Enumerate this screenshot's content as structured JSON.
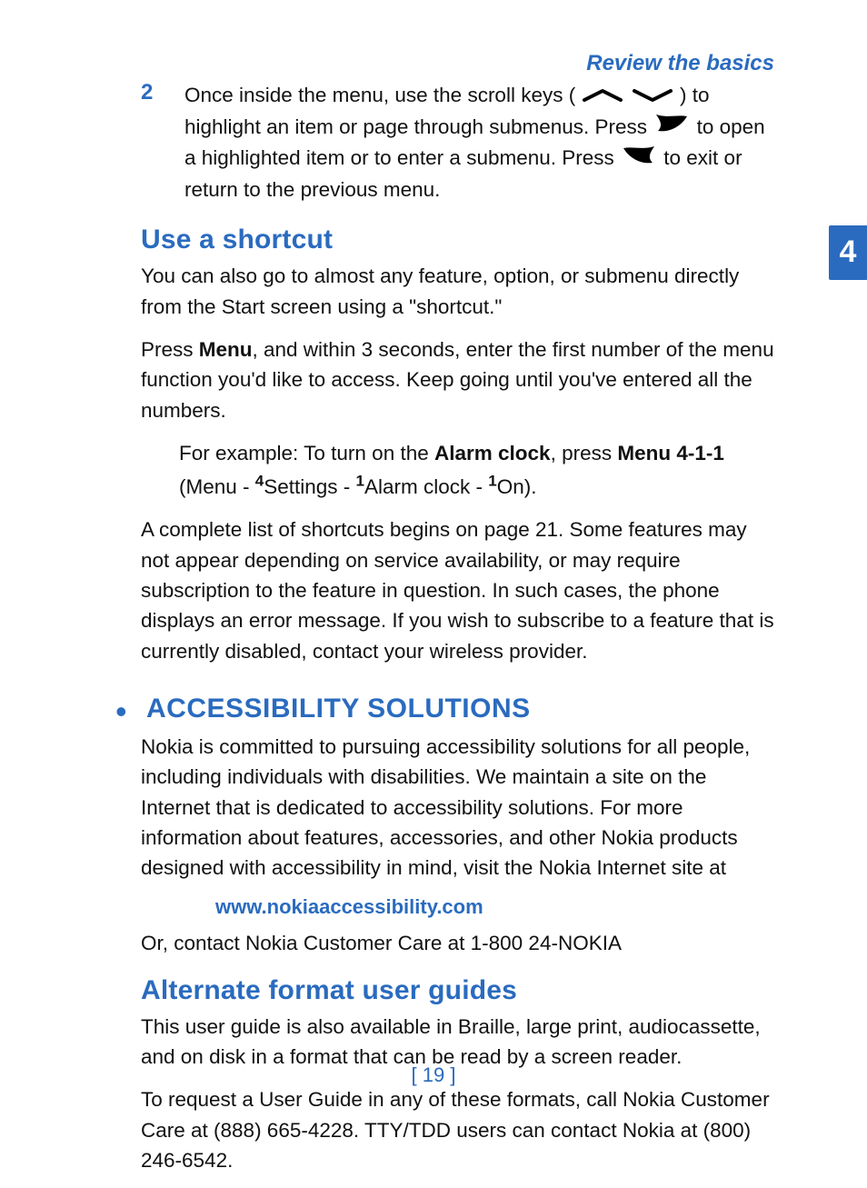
{
  "header": {
    "title": "Review the basics"
  },
  "sideTab": {
    "number": "4"
  },
  "step2": {
    "num": "2",
    "a": "Once inside the menu, use the scroll keys (",
    "b": ") to highlight an item or page through submenus. Press ",
    "c": " to open a highlighted item or to enter a submenu. Press ",
    "d": " to exit or return to the previous menu."
  },
  "shortcut": {
    "heading": "Use a shortcut",
    "p1": "You can also go to almost any feature, option, or submenu directly from the Start screen using a \"shortcut.\"",
    "p2_a": "Press ",
    "p2_menu": "Menu",
    "p2_b": ", and within 3 seconds, enter the first number of the menu function you'd like to access. Keep going until you've entered all the numbers.",
    "ex_a": "For example: To turn on the ",
    "ex_alarm": "Alarm clock",
    "ex_b": ", press ",
    "ex_code": "Menu 4-1-1",
    "ex_line2_a": "(Menu - ",
    "sup4": "4",
    "ex_settings": "Settings - ",
    "sup1a": "1",
    "ex_alarm2": "Alarm clock - ",
    "sup1b": "1",
    "ex_on": "On).",
    "p3": "A complete list of shortcuts begins on page 21. Some features may not appear depending on service availability, or may require subscription to the feature in question. In such cases, the phone displays an error message. If you wish to subscribe to a feature that is currently disabled, contact your wireless provider."
  },
  "access": {
    "heading": "ACCESSIBILITY SOLUTIONS",
    "p1": "Nokia is committed to pursuing accessibility solutions for all people, including individuals with disabilities. We maintain a site on the Internet that is dedicated to accessibility solutions. For more information about features, accessories, and other Nokia products designed with accessibility in mind, visit the Nokia Internet site at",
    "link": "www.nokiaaccessibility.com",
    "p2": "Or, contact Nokia Customer Care at 1-800 24-NOKIA"
  },
  "alt": {
    "heading": "Alternate format user guides",
    "p1": "This user guide is also available in Braille, large print, audiocassette, and on disk in a format that can be read by a screen reader.",
    "p2": "To request a User Guide in any of these formats, call Nokia Customer Care at (888) 665-4228. TTY/TDD users can contact Nokia at (800) 246-6542."
  },
  "footer": {
    "page": "[ 19 ]"
  }
}
